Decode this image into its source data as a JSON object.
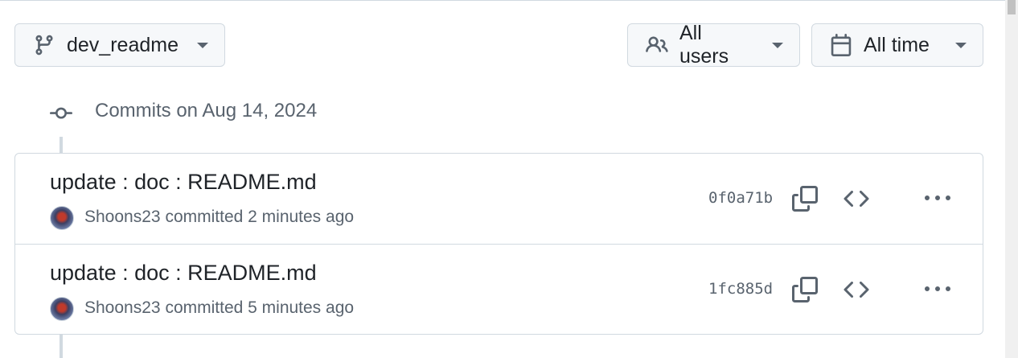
{
  "toolbar": {
    "branch_label": "dev_readme",
    "users_label": "All users",
    "time_label": "All time"
  },
  "commit_group": {
    "title": "Commits on Aug 14, 2024"
  },
  "commits": [
    {
      "message": "update : doc : README.md",
      "author": "Shoons23",
      "action": "committed",
      "time": "2 minutes ago",
      "sha": "0f0a71b"
    },
    {
      "message": "update : doc : README.md",
      "author": "Shoons23",
      "action": "committed",
      "time": "5 minutes ago",
      "sha": "1fc885d"
    }
  ],
  "icons": {
    "branch": "git-branch-icon",
    "users": "people-icon",
    "time": "calendar-icon",
    "group": "git-commit-icon",
    "copy": "copy-icon",
    "browse": "code-icon",
    "more": "kebab-horizontal-icon"
  },
  "colors": {
    "text": "#1f2328",
    "muted": "#59636e",
    "border": "#d1d9e0",
    "button_bg": "#f6f8fa"
  }
}
